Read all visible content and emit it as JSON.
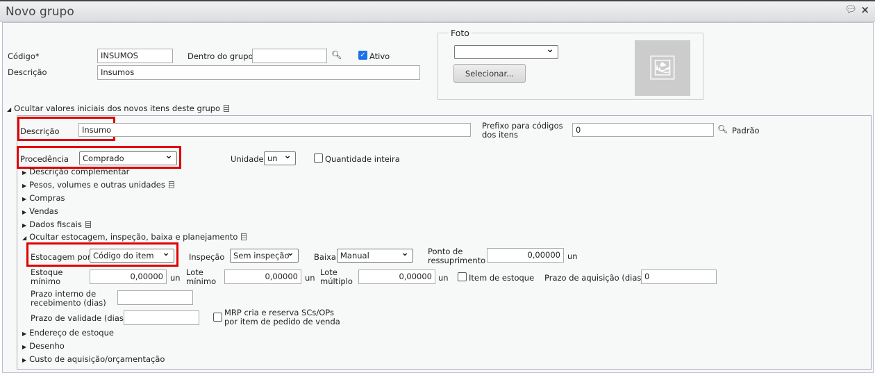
{
  "window": {
    "title": "Novo grupo",
    "chat_icon": "speech-bubble-icon",
    "close_icon": "close-icon"
  },
  "header": {
    "codigo_label": "Código*",
    "codigo_value": "INSUMOS",
    "dentro_label": "Dentro do grupo",
    "dentro_value": "",
    "ativo_label": "Ativo",
    "ativo_checked": true,
    "descricao_label": "Descrição",
    "descricao_value": "Insumos"
  },
  "foto": {
    "legend": "Foto",
    "select_value": "",
    "button": "Selecionar..."
  },
  "section": {
    "toggle_label": "Ocultar valores iniciais dos novos itens deste grupo",
    "descricao_label": "Descrição",
    "descricao_value": "Insumo",
    "prefixo_label": "Prefixo para códigos dos itens",
    "prefixo_value": "0",
    "padrao": "Padrão",
    "procedencia_label": "Procedência",
    "procedencia_value": "Comprado",
    "unidade_label": "Unidade",
    "unidade_value": "un",
    "qtd_inteira_label": "Quantidade inteira"
  },
  "collapsibles": [
    "Descrição complementar",
    "Pesos, volumes e outras unidades",
    "Compras",
    "Vendas",
    "Dados fiscais"
  ],
  "estoque": {
    "toggle_label": "Ocultar estocagem, inspeção, baixa e planejamento",
    "estocagem_label": "Estocagem por",
    "estocagem_value": "Código do item",
    "inspecao_label": "Inspeção",
    "inspecao_value": "Sem inspeção",
    "baixa_label": "Baixa",
    "baixa_value": "Manual",
    "ponto_label": "Ponto de ressuprimento",
    "ponto_value": "0,00000",
    "unit": "un",
    "estoque_min_label": "Estoque mínimo",
    "estoque_min_value": "0,00000",
    "lote_min_label": "Lote mínimo",
    "lote_min_value": "0,00000",
    "lote_mult_label": "Lote múltiplo",
    "lote_mult_value": "0,00000",
    "item_estoque_label": "Item de estoque",
    "prazo_aq_label": "Prazo de aquisição (dias)",
    "prazo_aq_value": "0",
    "prazo_receb_label": "Prazo interno de recebimento (dias)",
    "prazo_receb_value": "",
    "prazo_valid_label": "Prazo de validade (dias)",
    "prazo_valid_value": "",
    "mrp_label": "MRP cria e reserva SCs/OPs por item de pedido de venda"
  },
  "collapsibles2": [
    "Endereço de estoque",
    "Desenho",
    "Custo de aquisição/orçamentação"
  ]
}
